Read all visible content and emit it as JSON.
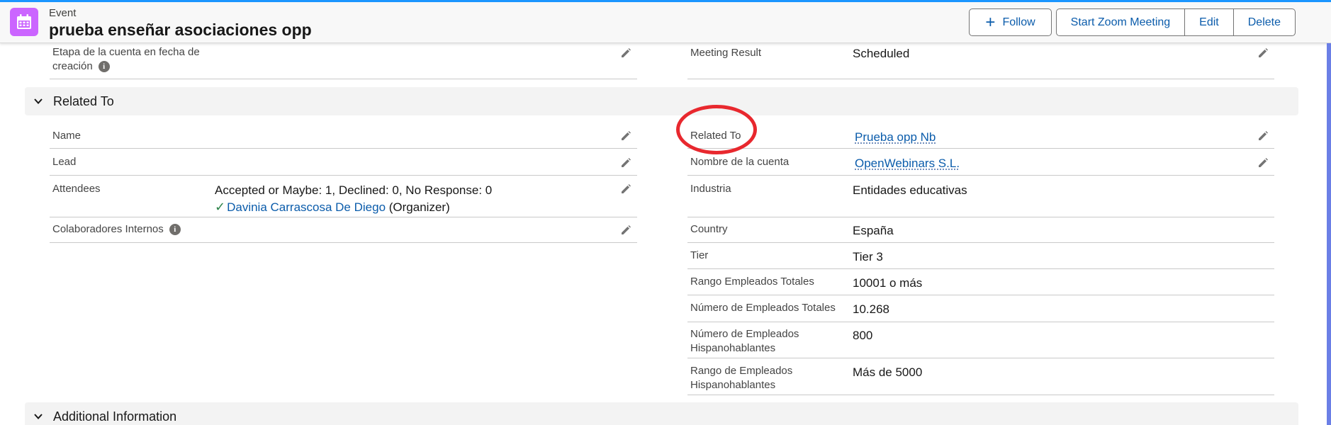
{
  "header": {
    "object_type": "Event",
    "title": "prueba enseñar asociaciones opp",
    "icon": "calendar-icon",
    "icon_color": "#cb65ff",
    "buttons": {
      "follow": "Follow",
      "start_zoom": "Start Zoom Meeting",
      "edit": "Edit",
      "delete": "Delete"
    }
  },
  "top_fields": {
    "etapa_label": "Etapa de la cuenta en fecha de creación",
    "meeting_result_label": "Meeting Result",
    "meeting_result_value": "Scheduled"
  },
  "related_section": {
    "title": "Related To",
    "left": {
      "name_label": "Name",
      "lead_label": "Lead",
      "attendees_label": "Attendees",
      "attendees_summary": "Accepted or Maybe: 1, Declined: 0, No Response: 0",
      "attendee_name": "Davinia Carrascosa De Diego",
      "attendee_role": "(Organizer)",
      "colaboradores_label": "Colaboradores Internos"
    },
    "right": {
      "related_to_label": "Related To",
      "related_to_value": "Prueba opp Nb",
      "cuenta_label": "Nombre de la cuenta",
      "cuenta_value": "OpenWebinars S.L.",
      "industria_label": "Industria",
      "industria_value": "Entidades educativas",
      "country_label": "Country",
      "country_value": "España",
      "tier_label": "Tier",
      "tier_value": "Tier 3",
      "rango_total_label": "Rango Empleados Totales",
      "rango_total_value": "10001 o más",
      "numero_total_label": "Número de Empleados Totales",
      "numero_total_value": "10.268",
      "numero_hisp_label": "Número de Empleados Hispanohablantes",
      "numero_hisp_value": "800",
      "rango_hisp_label": "Rango de Empleados Hispanohablantes",
      "rango_hisp_value": "Más de 5000"
    }
  },
  "additional_section": {
    "title": "Additional Information"
  },
  "colors": {
    "accent_blue": "#0b5cab",
    "annotation_red": "#e8282e",
    "check_green": "#2e844a"
  }
}
